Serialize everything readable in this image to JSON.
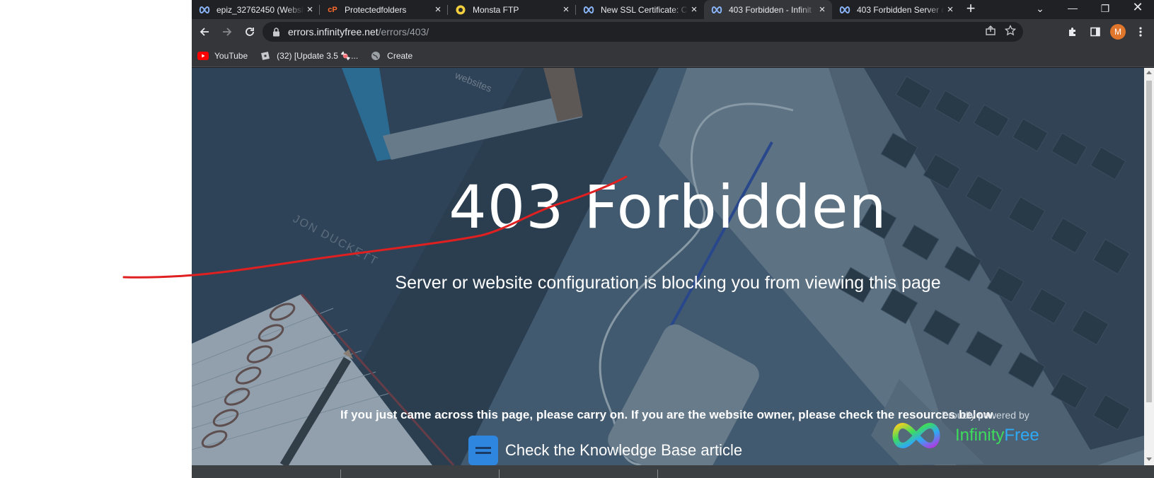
{
  "tabs": [
    {
      "title": "epiz_32762450 (Website",
      "favicon": "infinity-icon",
      "active": false
    },
    {
      "title": "Protectedfolders",
      "favicon": "cpanel-icon",
      "active": false
    },
    {
      "title": "Monsta FTP",
      "favicon": "monsta-icon",
      "active": false
    },
    {
      "title": "New SSL Certificate: C",
      "favicon": "infinity-icon",
      "active": false
    },
    {
      "title": "403 Forbidden - Infinit",
      "favicon": "infinity-icon",
      "active": true
    },
    {
      "title": "403 Forbidden Server c",
      "favicon": "infinity-icon",
      "active": false
    }
  ],
  "new_tab_label": "+",
  "address": {
    "host": "errors.infinityfree.net",
    "path": "/errors/403/"
  },
  "bookmarks": [
    {
      "label": "YouTube",
      "icon": "youtube-icon"
    },
    {
      "label": "(32) [Update 3.5 🍬...",
      "icon": "roblox-icon"
    },
    {
      "label": "Create",
      "icon": "globe-icon"
    }
  ],
  "profile_initial": "M",
  "page": {
    "headline": "403 Forbidden",
    "subline": "Server or website configuration is blocking you from viewing this page",
    "notice": "If you just came across this page, please carry on. If you are the website owner, please check the resources below.",
    "kb_link": "Check the Knowledge Base article",
    "powered_by": "Proudly powered by",
    "brand_part1": "Infinity",
    "brand_part2": "Free",
    "book_author": "JON DUCKETT",
    "book_word": "websites"
  },
  "colors": {
    "brand_green": "#3ddc5d",
    "brand_blue": "#2ea9f5",
    "pen_red": "#e02020",
    "kb_icon_bg": "#2e86de"
  }
}
